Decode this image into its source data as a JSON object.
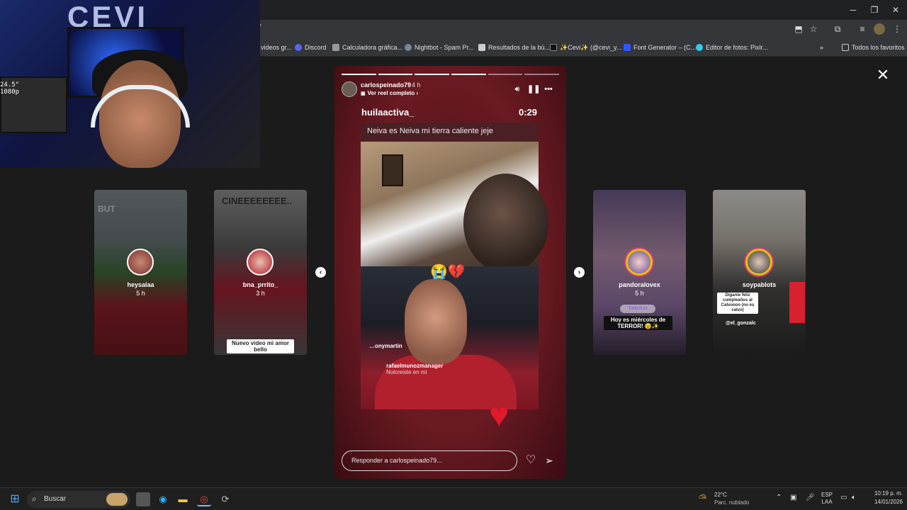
{
  "browser": {
    "url_fragment": "/",
    "window_controls": [
      "─",
      "❐",
      "✕"
    ],
    "bookmarks": [
      {
        "label": "videos gr...",
        "icon": "video-icon",
        "color": "#888888"
      },
      {
        "label": "Discord",
        "icon": "discord-icon",
        "color": "#5865f2"
      },
      {
        "label": "Calculadora gráfica...",
        "icon": "graph-icon",
        "color": "#aaaaaa"
      },
      {
        "label": "Nightbot - Spam Pr...",
        "icon": "nightbot-icon",
        "color": "#8899aa"
      },
      {
        "label": "Resultados de la bú...",
        "icon": "search-result-icon",
        "color": "#cccccc"
      },
      {
        "label": "✨Cevi✨ (@cevi_y...",
        "icon": "tiktok-icon",
        "color": "#111111"
      },
      {
        "label": "Font Generator – (C...",
        "icon": "font-generator-icon",
        "color": "#3355ff"
      },
      {
        "label": "Editor de fotos: Pixlr...",
        "icon": "pixlr-icon",
        "color": "#33ccee"
      }
    ],
    "all_bookmarks_label": "Todos los favoritos"
  },
  "webcam": {
    "logo_text": "CEVI",
    "monitor_readout": "24.5\"\n1080p"
  },
  "side_stories": [
    {
      "id": "story1",
      "user": "heysalaa",
      "time": "5 h",
      "caption": "BUT"
    },
    {
      "id": "story2",
      "user": "bna_prrito_",
      "time": "3 h",
      "caption": "CINEEEEEEEE..",
      "sub_caption": "Nuevo video mi amor bello"
    },
    {
      "id": "story3",
      "user": "pandoralovex",
      "time": "5 h",
      "twitch": "Twitch.tv",
      "caption": "Hoy es miércoles de TERROR! 😉✨"
    },
    {
      "id": "story4",
      "user": "soypablots",
      "time": "",
      "caption": "Díganle feliz cumpleaños al Calvoooo (no es calvo)",
      "handle": "@el_gonzalc"
    }
  ],
  "main_story": {
    "owner": "carlospeinado79",
    "time": "4 h",
    "reel_link": "Ver reel completo",
    "progress": [
      1,
      1,
      1,
      1,
      0,
      0
    ],
    "video": {
      "username": "huilaactiva_",
      "duration": "0:29",
      "caption": "Neiva es Neiva mi tierra caliente jeje",
      "comments": [
        {
          "user": "…onymartin",
          "text": ""
        },
        {
          "user": "rafaelmunozmanager",
          "text": "Nolcreiste en mi"
        }
      ],
      "emoji_overlay": "😭💔"
    },
    "reply_placeholder": "Responder a carlospeinado79..."
  },
  "taskbar": {
    "search_label": "Buscar",
    "weather_temp": "22°C",
    "weather_cond": "Parc. nublado",
    "language": "ESP",
    "layout": "LAA",
    "time": "10:19 p. m.",
    "date": "14/01/2026"
  }
}
